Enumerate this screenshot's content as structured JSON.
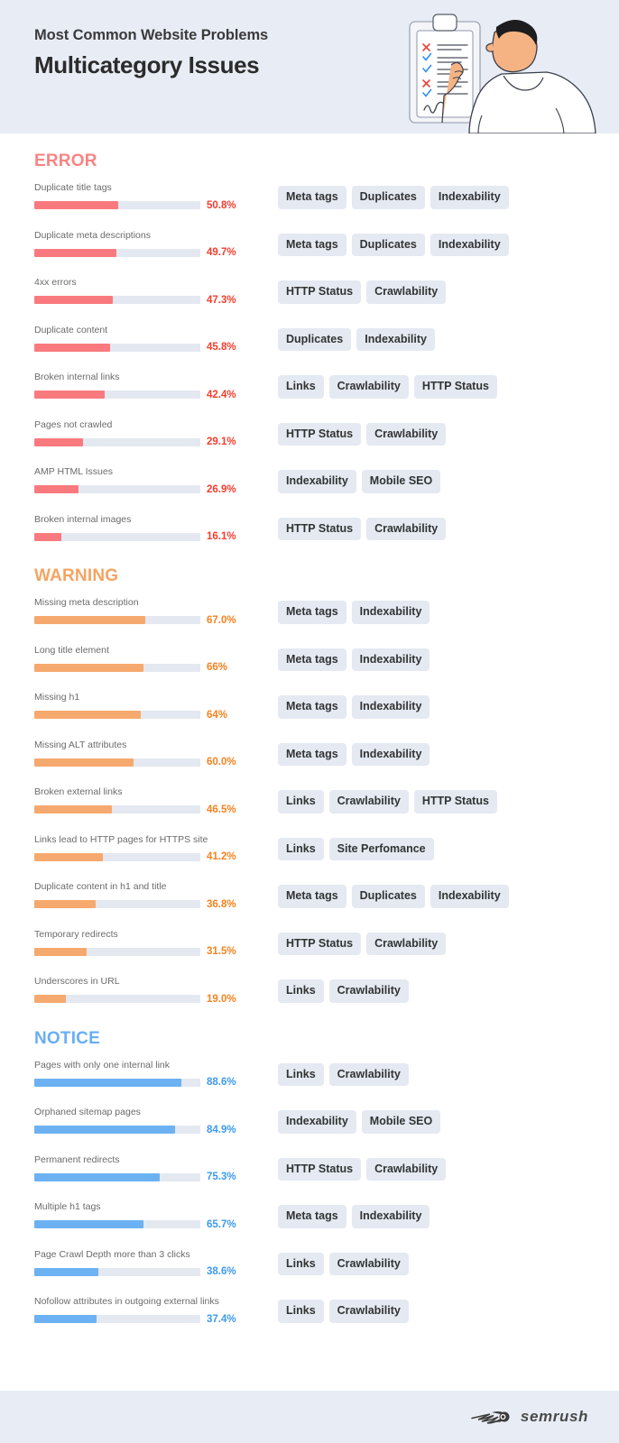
{
  "header": {
    "kicker": "Most Common Website Problems",
    "title": "Multicategory Issues",
    "bg_color": "#e8ecf5"
  },
  "footer": {
    "brand": "semrush"
  },
  "colors": {
    "error": "#f97a7e",
    "error_text": "#f43d2e",
    "error_heading": "#fa8383",
    "warning": "#f6a96e",
    "warning_text": "#f58220",
    "warning_heading": "#f5a462",
    "notice": "#6cb2f2",
    "notice_text": "#3c9af0",
    "notice_heading": "#69aef5",
    "track": "#e4e8f0",
    "tag_bg": "#e4e9f2"
  },
  "chart_data": {
    "type": "bar",
    "title": "Multicategory Issues",
    "subtitle": "Most Common Website Problems",
    "xlabel": "",
    "ylabel": "",
    "xlim": [
      0,
      100
    ],
    "grid": false,
    "legend": "none",
    "orientation": "horizontal",
    "unit": "%",
    "series": [
      {
        "name": "ERROR",
        "color": "#f97a7e",
        "categories": [
          "Duplicate title tags",
          "Duplicate meta descriptions",
          "4xx errors",
          "Duplicate content",
          "Broken internal links",
          "Pages not crawled",
          "AMP HTML Issues",
          "Broken internal images"
        ],
        "values": [
          50.8,
          49.7,
          47.3,
          45.8,
          42.4,
          29.1,
          26.9,
          16.1
        ],
        "labels": [
          "50.8%",
          "49.7%",
          "47.3%",
          "45.8%",
          "42.4%",
          "29.1%",
          "26.9%",
          "16.1%"
        ]
      },
      {
        "name": "WARNING",
        "color": "#f6a96e",
        "categories": [
          "Missing meta description",
          "Long title element",
          "Missing h1",
          "Missing ALT attributes",
          "Broken external links",
          "Links lead to HTTP pages for HTTPS site",
          "Duplicate content in h1 and title",
          "Temporary redirects",
          "Underscores in URL"
        ],
        "values": [
          67.0,
          66,
          64,
          60.0,
          46.5,
          41.2,
          36.8,
          31.5,
          19.0
        ],
        "labels": [
          "67.0%",
          "66%",
          "64%",
          "60.0%",
          "46.5%",
          "41.2%",
          "36.8%",
          "31.5%",
          "19.0%"
        ]
      },
      {
        "name": "NOTICE",
        "color": "#6cb2f2",
        "categories": [
          "Pages with only one internal link",
          "Orphaned sitemap pages",
          "Permanent redirects",
          "Multiple h1 tags",
          "Page Crawl Depth more than 3 clicks",
          "Nofollow attributes in outgoing external links"
        ],
        "values": [
          88.6,
          84.9,
          75.3,
          65.7,
          38.6,
          37.4
        ],
        "labels": [
          "88.6%",
          "84.9%",
          "75.3%",
          "65.7%",
          "38.6%",
          "37.4%"
        ]
      }
    ]
  },
  "sections": [
    {
      "id": "error",
      "heading": "ERROR",
      "rows": [
        {
          "label": "Duplicate title tags",
          "value": 50.8,
          "pct": "50.8%",
          "tags": [
            "Meta tags",
            "Duplicates",
            "Indexability"
          ]
        },
        {
          "label": "Duplicate meta descriptions",
          "value": 49.7,
          "pct": "49.7%",
          "tags": [
            "Meta tags",
            "Duplicates",
            "Indexability"
          ]
        },
        {
          "label": "4xx errors",
          "value": 47.3,
          "pct": "47.3%",
          "tags": [
            "HTTP Status",
            "Crawlability"
          ]
        },
        {
          "label": "Duplicate content",
          "value": 45.8,
          "pct": "45.8%",
          "tags": [
            "Duplicates",
            "Indexability"
          ]
        },
        {
          "label": "Broken internal links",
          "value": 42.4,
          "pct": "42.4%",
          "tags": [
            "Links",
            "Crawlability",
            "HTTP Status"
          ]
        },
        {
          "label": "Pages not crawled",
          "value": 29.1,
          "pct": "29.1%",
          "tags": [
            "HTTP Status",
            "Crawlability"
          ]
        },
        {
          "label": "AMP HTML Issues",
          "value": 26.9,
          "pct": "26.9%",
          "tags": [
            "Indexability",
            "Mobile SEO"
          ]
        },
        {
          "label": "Broken internal images",
          "value": 16.1,
          "pct": "16.1%",
          "tags": [
            "HTTP Status",
            "Crawlability"
          ]
        }
      ]
    },
    {
      "id": "warning",
      "heading": "WARNING",
      "rows": [
        {
          "label": "Missing meta description",
          "value": 67.0,
          "pct": "67.0%",
          "tags": [
            "Meta tags",
            "Indexability"
          ]
        },
        {
          "label": "Long title element",
          "value": 66,
          "pct": "66%",
          "tags": [
            "Meta tags",
            "Indexability"
          ]
        },
        {
          "label": "Missing h1",
          "value": 64,
          "pct": "64%",
          "tags": [
            "Meta tags",
            "Indexability"
          ]
        },
        {
          "label": "Missing ALT attributes",
          "value": 60.0,
          "pct": "60.0%",
          "tags": [
            "Meta tags",
            "Indexability"
          ]
        },
        {
          "label": "Broken external links",
          "value": 46.5,
          "pct": "46.5%",
          "tags": [
            "Links",
            "Crawlability",
            "HTTP Status"
          ]
        },
        {
          "label": "Links lead to HTTP pages for HTTPS site",
          "value": 41.2,
          "pct": "41.2%",
          "tags": [
            "Links",
            "Site Perfomance"
          ]
        },
        {
          "label": "Duplicate content in h1 and title",
          "value": 36.8,
          "pct": "36.8%",
          "tags": [
            "Meta tags",
            "Duplicates",
            "Indexability"
          ]
        },
        {
          "label": "Temporary redirects",
          "value": 31.5,
          "pct": "31.5%",
          "tags": [
            "HTTP Status",
            "Crawlability"
          ]
        },
        {
          "label": "Underscores in URL",
          "value": 19.0,
          "pct": "19.0%",
          "tags": [
            "Links",
            "Crawlability"
          ]
        }
      ]
    },
    {
      "id": "notice",
      "heading": "NOTICE",
      "rows": [
        {
          "label": "Pages with only one internal link",
          "value": 88.6,
          "pct": "88.6%",
          "tags": [
            "Links",
            "Crawlability"
          ]
        },
        {
          "label": "Orphaned sitemap pages",
          "value": 84.9,
          "pct": "84.9%",
          "tags": [
            "Indexability",
            "Mobile SEO"
          ]
        },
        {
          "label": "Permanent redirects",
          "value": 75.3,
          "pct": "75.3%",
          "tags": [
            "HTTP Status",
            "Crawlability"
          ]
        },
        {
          "label": "Multiple h1 tags",
          "value": 65.7,
          "pct": "65.7%",
          "tags": [
            "Meta tags",
            "Indexability"
          ]
        },
        {
          "label": "Page Crawl Depth more than 3 clicks",
          "value": 38.6,
          "pct": "38.6%",
          "tags": [
            "Links",
            "Crawlability"
          ]
        },
        {
          "label": "Nofollow attributes in outgoing external links",
          "value": 37.4,
          "pct": "37.4%",
          "tags": [
            "Links",
            "Crawlability"
          ]
        }
      ]
    }
  ]
}
